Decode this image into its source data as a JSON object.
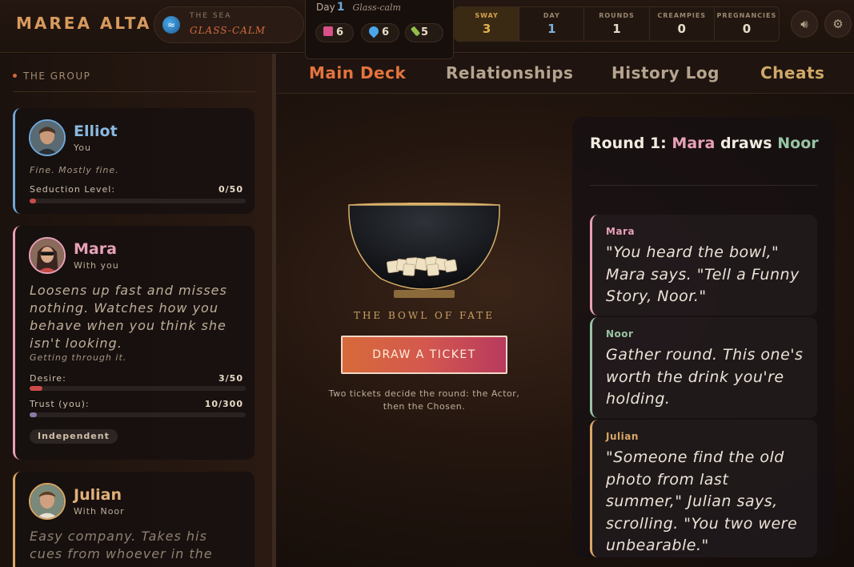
{
  "app": {
    "title": "MAREA ALTA"
  },
  "sea": {
    "label": "THE SEA",
    "value": "GLASS-CALM",
    "icon": "wave-icon"
  },
  "day_box": {
    "prefix": "Day",
    "day": "1",
    "weather": "Glass-calm",
    "resources": [
      {
        "name": "drink",
        "icon": "cup-icon",
        "value": "6",
        "color": "#d9508a"
      },
      {
        "name": "water",
        "icon": "droplet-icon",
        "value": "6",
        "color": "#4aa8e8"
      },
      {
        "name": "bottle",
        "icon": "bottle-icon",
        "value": "5",
        "color": "#8fbf4a"
      }
    ]
  },
  "stats": [
    {
      "label": "SWAY",
      "value": "3"
    },
    {
      "label": "DAY",
      "value": "1"
    },
    {
      "label": "ROUNDS",
      "value": "1"
    },
    {
      "label": "CREAMPIES",
      "value": "0"
    },
    {
      "label": "PREGNANCIES",
      "value": "0"
    }
  ],
  "controls": {
    "sound_icon": "speaker-icon",
    "settings_icon": "gear-icon"
  },
  "sidebar": {
    "title": "THE GROUP",
    "cards": [
      {
        "name": "Elliot",
        "sub": "You",
        "accent": "#6fa8d8",
        "mood": "Fine. Mostly fine.",
        "bars": [
          {
            "label": "Seduction Level:",
            "value": "0/50",
            "fraction": 0.0
          }
        ]
      },
      {
        "name": "Mara",
        "sub": "With you",
        "accent": "#e8a0b8",
        "desc": "Loosens up fast and misses nothing. Watches how you behave when you think she isn't looking.",
        "mood": "Getting through it.",
        "bars": [
          {
            "label": "Desire:",
            "value": "3/50",
            "fraction": 0.06
          },
          {
            "label": "Trust (you):",
            "value": "10/300",
            "fraction": 0.033
          }
        ],
        "tag": "Independent"
      },
      {
        "name": "Julian",
        "sub": "With Noor",
        "accent": "#d9a766",
        "desc": "Easy company. Takes his cues from whoever in the room..."
      }
    ]
  },
  "tabs": [
    {
      "label": "Main Deck"
    },
    {
      "label": "Relationships"
    },
    {
      "label": "History Log"
    },
    {
      "label": "Cheats"
    }
  ],
  "deck": {
    "bowl_title": "THE BOWL OF FATE",
    "draw_label": "DRAW A TICKET",
    "hint": "Two tickets decide the round: the Actor, then the Chosen."
  },
  "round": {
    "prefix": "Round 1:",
    "actor": "Mara",
    "verb": "draws",
    "chosen": "Noor",
    "entries": [
      {
        "who": "Mara",
        "color": "#e8a0b8",
        "text": "\"You heard the bowl,\" Mara says. \"Tell a Funny Story, Noor.\""
      },
      {
        "who": "Noor",
        "color": "#98c4a4",
        "text": "Gather round. This one's worth the drink you're holding."
      },
      {
        "who": "Julian",
        "color": "#d9a766",
        "text": "\"Someone find the old photo from last summer,\" Julian says, scrolling. \"You two were unbearable.\""
      }
    ]
  }
}
